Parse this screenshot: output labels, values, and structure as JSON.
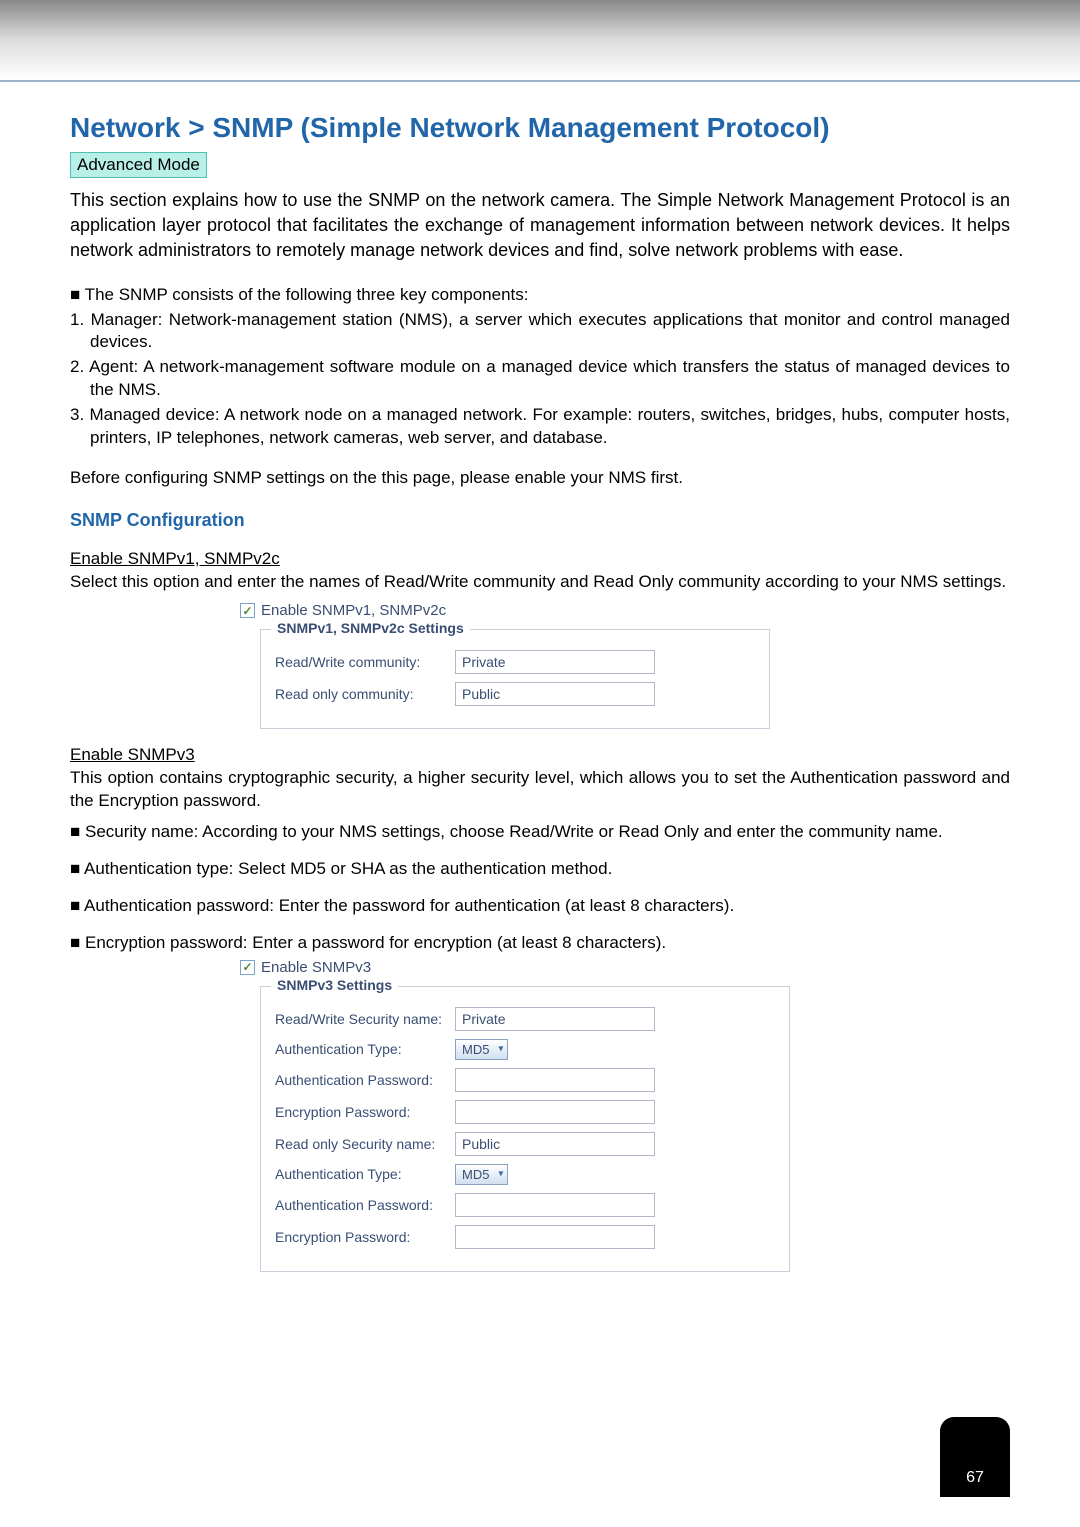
{
  "page_title": "Network > SNMP (Simple Network Management Protocol)",
  "mode_badge": "Advanced Mode",
  "intro": "This section explains how to use the SNMP on the network camera. The Simple Network Management Protocol is an application layer protocol that facilitates the exchange of management information between network devices. It helps network administrators to remotely manage network devices and find, solve network problems with ease.",
  "components_intro": "■ The SNMP consists of the following three key components:",
  "components": {
    "c1": "1. Manager: Network-management station (NMS), a server which executes applications that monitor and control managed devices.",
    "c2": "2. Agent: A network-management software module on a managed device which transfers the status of managed devices to the NMS.",
    "c3": "3. Managed device: A network node on a managed network. For example: routers, switches, bridges, hubs, computer hosts, printers, IP telephones, network cameras, web server, and database."
  },
  "before_config": "Before configuring SNMP settings on the this page, please enable your NMS first.",
  "config_header": "SNMP Configuration",
  "snmpv12": {
    "title": "Enable SNMPv1, SNMPv2c",
    "desc": "Select this option and enter the names of Read/Write community and Read Only community according to your NMS settings.",
    "checkbox_label": "Enable SNMPv1, SNMPv2c",
    "legend": "SNMPv1, SNMPv2c Settings",
    "rw_label": "Read/Write community:",
    "rw_value": "Private",
    "ro_label": "Read only community:",
    "ro_value": "Public"
  },
  "snmpv3": {
    "title": "Enable SNMPv3",
    "desc": "This option contains cryptographic security, a higher security level, which allows you to set the Authentication password and the Encryption password.",
    "bullets": {
      "b1": "■ Security name: According to your NMS settings, choose Read/Write or Read Only and enter the community name.",
      "b2": "■ Authentication type: Select MD5 or SHA as the authentication method.",
      "b3": "■ Authentication password: Enter the password for authentication (at least 8 characters).",
      "b4": "■ Encryption password: Enter a password for encryption (at least 8 characters)."
    },
    "checkbox_label": "Enable SNMPv3",
    "legend": "SNMPv3 Settings",
    "rw_sec_label": "Read/Write Security name:",
    "rw_sec_value": "Private",
    "auth_type_label": "Authentication Type:",
    "auth_type_value": "MD5",
    "auth_pwd_label": "Authentication Password:",
    "enc_pwd_label": "Encryption Password:",
    "ro_sec_label": "Read only Security name:",
    "ro_sec_value": "Public"
  },
  "page_number": "67"
}
